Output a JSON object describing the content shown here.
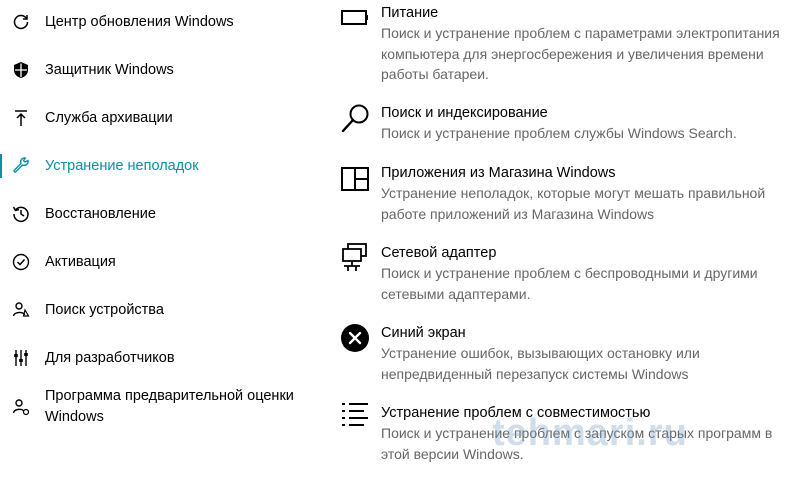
{
  "sidebar": {
    "items": [
      {
        "label": "Центр обновления Windows",
        "icon": "refresh-icon"
      },
      {
        "label": "Защитник Windows",
        "icon": "shield-icon"
      },
      {
        "label": "Служба архивации",
        "icon": "upload-arrow-icon"
      },
      {
        "label": "Устранение неполадок",
        "icon": "wrench-icon",
        "active": true
      },
      {
        "label": "Восстановление",
        "icon": "history-icon"
      },
      {
        "label": "Активация",
        "icon": "check-circle-icon"
      },
      {
        "label": "Поиск устройства",
        "icon": "person-location-icon"
      },
      {
        "label": "Для разработчиков",
        "icon": "developer-tools-icon"
      },
      {
        "label": "Программа предварительной оценки Windows",
        "icon": "insider-person-icon"
      }
    ],
    "accent_color": "#0a8fa3"
  },
  "main": {
    "items": [
      {
        "title": "Питание",
        "description": "Поиск и устранение проблем с параметрами электропитания компьютера для энергосбережения и увеличения  времени работы батареи.",
        "icon": "battery-icon"
      },
      {
        "title": "Поиск и индексирование",
        "description": "Поиск и устранение проблем службы Windows Search.",
        "icon": "search-icon"
      },
      {
        "title": "Приложения из Магазина Windows",
        "description": "Устранение неполадок, которые могут мешать правильной работе приложений из Магазина Windows",
        "icon": "store-app-icon"
      },
      {
        "title": "Сетевой адаптер",
        "description": "Поиск и устранение проблем с беспроводными и другими сетевыми адаптерами.",
        "icon": "network-adapter-icon"
      },
      {
        "title": "Синий экран",
        "description": "Устранение ошибок, вызывающих остановку или непредвиденный перезапуск системы Windows",
        "icon": "blue-screen-x-icon"
      },
      {
        "title": "Устранение проблем с совместимостью",
        "description": "Поиск и устранение проблем с запуском старых программ в этой версии Windows.",
        "icon": "compatibility-list-icon"
      }
    ],
    "description_color": "#666666"
  },
  "watermark": {
    "text": "tehmari.ru"
  }
}
